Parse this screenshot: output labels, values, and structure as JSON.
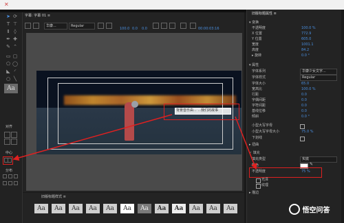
{
  "titlepanel": {
    "tab_title": "字幕: 字幕 01 ≡",
    "font_name": "华康...",
    "font_style": "Regular",
    "readouts": [
      "100.0",
      "0.0",
      "0.0"
    ],
    "timecode": "00:00:03:16"
  },
  "caption": {
    "text": "背景音乐由...  ...我们的故事"
  },
  "styles": {
    "panel_title": "旧版标题样式 ≡",
    "swatches": [
      "Aa",
      "Aa",
      "Aa",
      "Aa",
      "Aa",
      "Aa",
      "Aa",
      "Aa",
      "Aa",
      "Aa",
      "Aa",
      "Aa"
    ]
  },
  "align": {
    "title": "对齐",
    "center": "中心",
    "distribute": "分布"
  },
  "properties": {
    "panel_title": "旧版标题属性 ≡",
    "transform": "▾ 变换",
    "opacity_label": "不透明度",
    "opacity_value": "100.0 %",
    "x_label": "X 位置",
    "x_value": "772.9",
    "y_label": "Y 位置",
    "y_value": "605.0",
    "width_label": "宽度",
    "width_value": "1001.1",
    "height_label": "高度",
    "height_value": "84.2",
    "rotation_label": "▸ 旋转",
    "rotation_value": "0.0 °",
    "props": "▾ 属性",
    "font_family_label": "字体系列",
    "font_family_value": "华康少女文字...",
    "font_style_label": "字体样式",
    "font_style_value": "Regular",
    "font_size_label": "字体大小",
    "font_size_value": "65.0",
    "aspect_label": "宽高比",
    "aspect_value": "100.0 %",
    "leading_label": "行距",
    "leading_value": "0.0",
    "kerning_label": "字偶间距",
    "kerning_value": "0.0",
    "tracking_label": "字符间距",
    "tracking_value": "0.0",
    "baseline_label": "基线位移",
    "baseline_value": "0.0",
    "slant_label": "倾斜",
    "slant_value": "0.0 °",
    "smallcaps_label": "小型大写字母",
    "smallcaps_size_label": "小型大写字母大小",
    "smallcaps_size_value": "75.0 %",
    "underline_label": "下划线",
    "distort_label": "▸ 扭曲",
    "fill_label": "✓ 填充",
    "fill_type_label": "填充类型",
    "fill_type_value": "实底",
    "color_label": "颜色",
    "fill_opacity_label": "不透明度",
    "fill_opacity_value": "75 %",
    "sheen_label": "光泽",
    "texture_label": "纹理",
    "stroke_label": "▸ 描边"
  },
  "watermark": "悟空问答",
  "colors": {
    "accent": "#4a90e2",
    "annotation": "#e02020"
  }
}
